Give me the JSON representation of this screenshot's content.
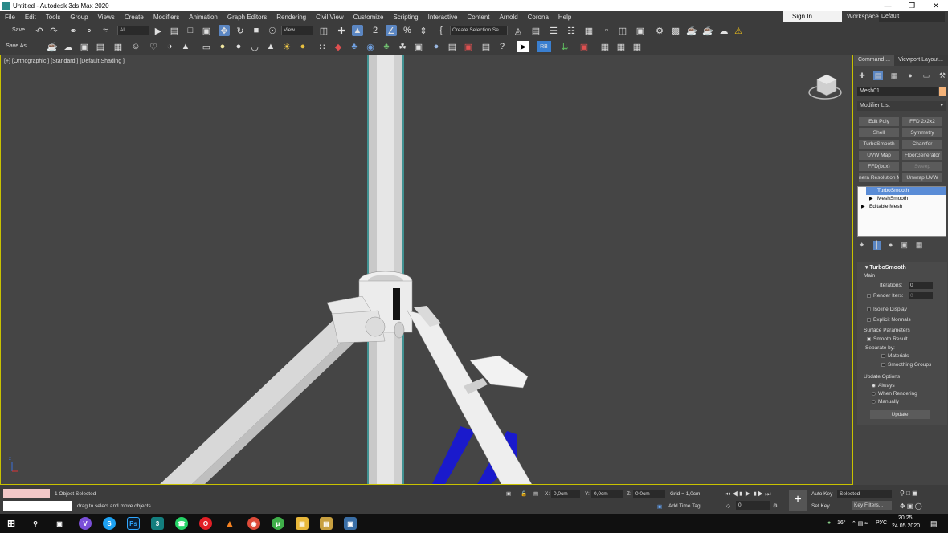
{
  "window": {
    "title": "Untitled - Autodesk 3ds Max 2020"
  },
  "menu": [
    "File",
    "Edit",
    "Tools",
    "Group",
    "Views",
    "Create",
    "Modifiers",
    "Animation",
    "Graph Editors",
    "Rendering",
    "Civil View",
    "Customize",
    "Scripting",
    "Interactive",
    "Content",
    "Arnold",
    "Corona",
    "Help"
  ],
  "account": {
    "sign_in": "Sign In",
    "workspaces_label": "Workspaces:",
    "workspace_value": "Default"
  },
  "toolbar": {
    "save": "Save",
    "save_as": "Save As...",
    "filter_value": "All",
    "ref_coord": "View",
    "selection_set": "Create Selection Se",
    "rb": "RB"
  },
  "viewport": {
    "label": "[+] [Orthographic ] [Standard ] [Default Shading ]"
  },
  "command_panel": {
    "tabs": [
      "Command ...",
      "Viewport Layout..."
    ],
    "object_name": "Mesh01",
    "modifier_list": "Modifier List",
    "modifier_buttons": [
      "Edit Poly",
      "FFD 2x2x2",
      "Shell",
      "Symmetry",
      "TurboSmooth",
      "Chamfer",
      "UVW Map",
      "FloorGenerator",
      "FFD(box)",
      "Sweep",
      "nera Resolution M",
      "Unwrap UVW"
    ],
    "stack": [
      "TurboSmooth",
      "MeshSmooth",
      "Editable Mesh"
    ]
  },
  "turbosmooth": {
    "title": "TurboSmooth",
    "main": "Main",
    "iterations_label": "Iterations:",
    "iterations_value": "0",
    "render_iters_label": "Render Iters:",
    "render_iters_value": "0",
    "isoline": "Isoline Display",
    "explicit_normals": "Explicit Normals",
    "surface_params": "Surface Parameters",
    "smooth_result": "Smooth Result",
    "separate_by": "Separate by:",
    "materials": "Materials",
    "smoothing_groups": "Smoothing Groups",
    "update_options": "Update Options",
    "always": "Always",
    "when_rendering": "When Rendering",
    "manually": "Manually",
    "update_button": "Update"
  },
  "status": {
    "selected": "1 Object Selected",
    "hint": "drag to select and move objects",
    "x_label": "X:",
    "x_value": "0,0cm",
    "y_label": "Y:",
    "y_value": "0,0cm",
    "z_label": "Z:",
    "z_value": "0,0cm",
    "grid": "Grid = 1,0cm",
    "add_time_tag": "Add Time Tag",
    "auto_key": "Auto Key",
    "set_key": "Set Key",
    "selected_dropdown": "Selected",
    "key_filters": "Key Filters...",
    "frame_value": "0"
  },
  "taskbar": {
    "time": "20:25",
    "date": "24.05.2020",
    "lang": "РУС",
    "temp": "16°"
  },
  "colors": {
    "viewport_border": "#c8c200",
    "selected_stack": "#5a8cd6",
    "pole": "#e8e8e8",
    "blue_part": "#1a1acc"
  }
}
